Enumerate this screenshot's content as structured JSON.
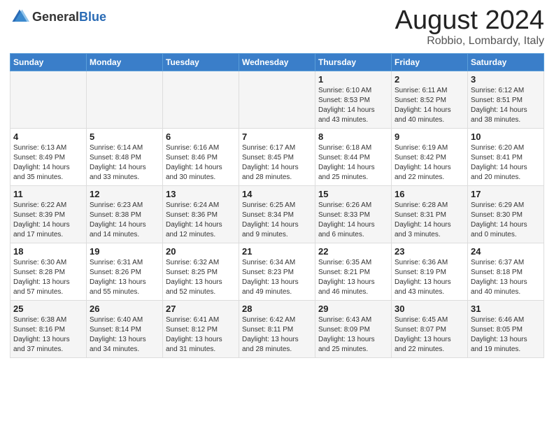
{
  "header": {
    "logo_general": "General",
    "logo_blue": "Blue",
    "title": "August 2024",
    "subtitle": "Robbio, Lombardy, Italy"
  },
  "weekdays": [
    "Sunday",
    "Monday",
    "Tuesday",
    "Wednesday",
    "Thursday",
    "Friday",
    "Saturday"
  ],
  "weeks": [
    [
      {
        "day": "",
        "info": ""
      },
      {
        "day": "",
        "info": ""
      },
      {
        "day": "",
        "info": ""
      },
      {
        "day": "",
        "info": ""
      },
      {
        "day": "1",
        "info": "Sunrise: 6:10 AM\nSunset: 8:53 PM\nDaylight: 14 hours\nand 43 minutes."
      },
      {
        "day": "2",
        "info": "Sunrise: 6:11 AM\nSunset: 8:52 PM\nDaylight: 14 hours\nand 40 minutes."
      },
      {
        "day": "3",
        "info": "Sunrise: 6:12 AM\nSunset: 8:51 PM\nDaylight: 14 hours\nand 38 minutes."
      }
    ],
    [
      {
        "day": "4",
        "info": "Sunrise: 6:13 AM\nSunset: 8:49 PM\nDaylight: 14 hours\nand 35 minutes."
      },
      {
        "day": "5",
        "info": "Sunrise: 6:14 AM\nSunset: 8:48 PM\nDaylight: 14 hours\nand 33 minutes."
      },
      {
        "day": "6",
        "info": "Sunrise: 6:16 AM\nSunset: 8:46 PM\nDaylight: 14 hours\nand 30 minutes."
      },
      {
        "day": "7",
        "info": "Sunrise: 6:17 AM\nSunset: 8:45 PM\nDaylight: 14 hours\nand 28 minutes."
      },
      {
        "day": "8",
        "info": "Sunrise: 6:18 AM\nSunset: 8:44 PM\nDaylight: 14 hours\nand 25 minutes."
      },
      {
        "day": "9",
        "info": "Sunrise: 6:19 AM\nSunset: 8:42 PM\nDaylight: 14 hours\nand 22 minutes."
      },
      {
        "day": "10",
        "info": "Sunrise: 6:20 AM\nSunset: 8:41 PM\nDaylight: 14 hours\nand 20 minutes."
      }
    ],
    [
      {
        "day": "11",
        "info": "Sunrise: 6:22 AM\nSunset: 8:39 PM\nDaylight: 14 hours\nand 17 minutes."
      },
      {
        "day": "12",
        "info": "Sunrise: 6:23 AM\nSunset: 8:38 PM\nDaylight: 14 hours\nand 14 minutes."
      },
      {
        "day": "13",
        "info": "Sunrise: 6:24 AM\nSunset: 8:36 PM\nDaylight: 14 hours\nand 12 minutes."
      },
      {
        "day": "14",
        "info": "Sunrise: 6:25 AM\nSunset: 8:34 PM\nDaylight: 14 hours\nand 9 minutes."
      },
      {
        "day": "15",
        "info": "Sunrise: 6:26 AM\nSunset: 8:33 PM\nDaylight: 14 hours\nand 6 minutes."
      },
      {
        "day": "16",
        "info": "Sunrise: 6:28 AM\nSunset: 8:31 PM\nDaylight: 14 hours\nand 3 minutes."
      },
      {
        "day": "17",
        "info": "Sunrise: 6:29 AM\nSunset: 8:30 PM\nDaylight: 14 hours\nand 0 minutes."
      }
    ],
    [
      {
        "day": "18",
        "info": "Sunrise: 6:30 AM\nSunset: 8:28 PM\nDaylight: 13 hours\nand 57 minutes."
      },
      {
        "day": "19",
        "info": "Sunrise: 6:31 AM\nSunset: 8:26 PM\nDaylight: 13 hours\nand 55 minutes."
      },
      {
        "day": "20",
        "info": "Sunrise: 6:32 AM\nSunset: 8:25 PM\nDaylight: 13 hours\nand 52 minutes."
      },
      {
        "day": "21",
        "info": "Sunrise: 6:34 AM\nSunset: 8:23 PM\nDaylight: 13 hours\nand 49 minutes."
      },
      {
        "day": "22",
        "info": "Sunrise: 6:35 AM\nSunset: 8:21 PM\nDaylight: 13 hours\nand 46 minutes."
      },
      {
        "day": "23",
        "info": "Sunrise: 6:36 AM\nSunset: 8:19 PM\nDaylight: 13 hours\nand 43 minutes."
      },
      {
        "day": "24",
        "info": "Sunrise: 6:37 AM\nSunset: 8:18 PM\nDaylight: 13 hours\nand 40 minutes."
      }
    ],
    [
      {
        "day": "25",
        "info": "Sunrise: 6:38 AM\nSunset: 8:16 PM\nDaylight: 13 hours\nand 37 minutes."
      },
      {
        "day": "26",
        "info": "Sunrise: 6:40 AM\nSunset: 8:14 PM\nDaylight: 13 hours\nand 34 minutes."
      },
      {
        "day": "27",
        "info": "Sunrise: 6:41 AM\nSunset: 8:12 PM\nDaylight: 13 hours\nand 31 minutes."
      },
      {
        "day": "28",
        "info": "Sunrise: 6:42 AM\nSunset: 8:11 PM\nDaylight: 13 hours\nand 28 minutes."
      },
      {
        "day": "29",
        "info": "Sunrise: 6:43 AM\nSunset: 8:09 PM\nDaylight: 13 hours\nand 25 minutes."
      },
      {
        "day": "30",
        "info": "Sunrise: 6:45 AM\nSunset: 8:07 PM\nDaylight: 13 hours\nand 22 minutes."
      },
      {
        "day": "31",
        "info": "Sunrise: 6:46 AM\nSunset: 8:05 PM\nDaylight: 13 hours\nand 19 minutes."
      }
    ]
  ]
}
